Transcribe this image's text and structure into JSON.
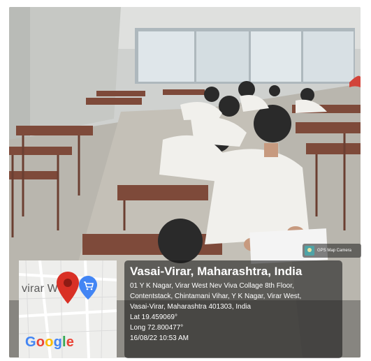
{
  "overlay": {
    "title": "Vasai-Virar, Maharashtra, India",
    "address_line1": "01 Y K Nagar, Virar West Nev Viva Collage 8th Floor,",
    "address_line2": "Contentstack, Chintamani Vihar, Y K Nagar, Virar West,",
    "address_line3": "Vasai-Virar, Maharashtra 401303, India",
    "latitude": "Lat 19.459069°",
    "longitude": "Long 72.800477°",
    "timestamp": "16/08/22 10:53 AM"
  },
  "map": {
    "town_label": "virar W",
    "brand": "Google",
    "pin_color": "#D93025",
    "shop_pin_color": "#4285F4"
  },
  "camera_badge": {
    "label": "GPS Map Camera"
  }
}
